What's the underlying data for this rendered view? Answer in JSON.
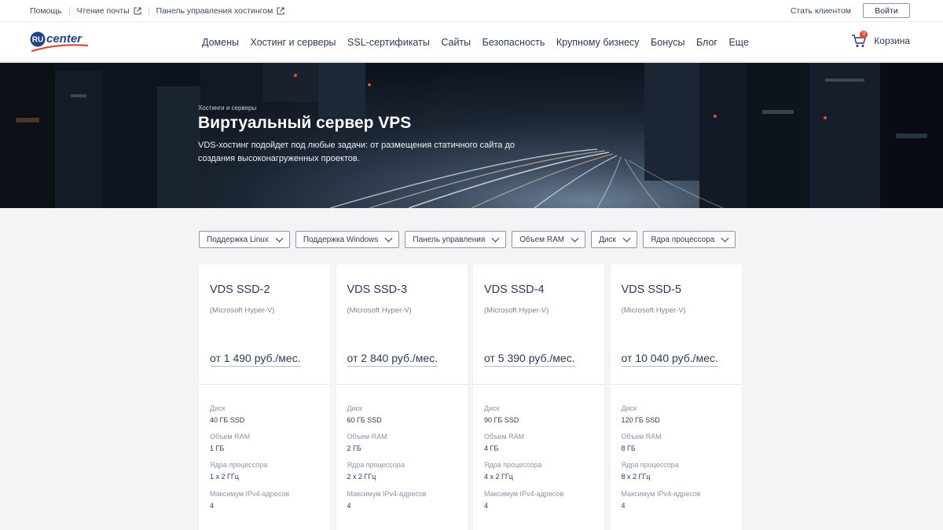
{
  "topbar": {
    "links": [
      "Помощь",
      "Чтение почты",
      "Панель управления хостингом"
    ],
    "become_client": "Стать клиентом",
    "login": "Войти"
  },
  "logo": {
    "ru": "RU",
    "center": "center"
  },
  "nav": [
    "Домены",
    "Хостинг и серверы",
    "SSL-сертификаты",
    "Сайты",
    "Безопасность",
    "Крупному бизнесу",
    "Бонусы",
    "Блог",
    "Еще"
  ],
  "cart": {
    "label": "Корзина",
    "count": "0"
  },
  "hero": {
    "breadcrumb": "Хостинги и серверы",
    "title": "Виртуальный сервер VPS",
    "description": "VDS-хостинг подойдет под любые задачи: от размещения статичного сайта до создания высоконагруженных проектов."
  },
  "filters": [
    "Поддержка Linux",
    "Поддержка Windows",
    "Панель управления",
    "Объем RAM",
    "Диск",
    "Ядра процессора"
  ],
  "spec_labels": {
    "disk": "Диск",
    "ram": "Объем RAM",
    "cpu": "Ядра процессора",
    "ipv4": "Максимум IPv4-адресов"
  },
  "plans": [
    {
      "name": "VDS SSD-2",
      "virt": "(Microsoft Hyper-V)",
      "price": "от 1 490 руб./мес.",
      "disk": "40 ГБ SSD",
      "ram": "1 ГБ",
      "cpu": "1 x 2 ГГц",
      "ipv4": "4"
    },
    {
      "name": "VDS SSD-3",
      "virt": "(Microsoft Hyper-V)",
      "price": "от 2 840 руб./мес.",
      "disk": "60 ГБ SSD",
      "ram": "2 ГБ",
      "cpu": "2 x 2 ГГц",
      "ipv4": "4"
    },
    {
      "name": "VDS SSD-4",
      "virt": "(Microsoft Hyper-V)",
      "price": "от 5 390 руб./мес.",
      "disk": "90 ГБ SSD",
      "ram": "4 ГБ",
      "cpu": "4 x 2 ГГц",
      "ipv4": "4"
    },
    {
      "name": "VDS SSD-5",
      "virt": "(Microsoft Hyper-V)",
      "price": "от 10 040 руб./мес.",
      "disk": "120 ГБ SSD",
      "ram": "8 ГБ",
      "cpu": "8 x 2 ГГц",
      "ipv4": "4"
    }
  ],
  "colors": {
    "brand_blue": "#1f3f86",
    "brand_red": "#e5432d",
    "text": "#2c3a55"
  },
  "icons": {
    "external": "external-link-icon",
    "cart": "cart-icon",
    "chevron": "chevron-down-icon"
  }
}
